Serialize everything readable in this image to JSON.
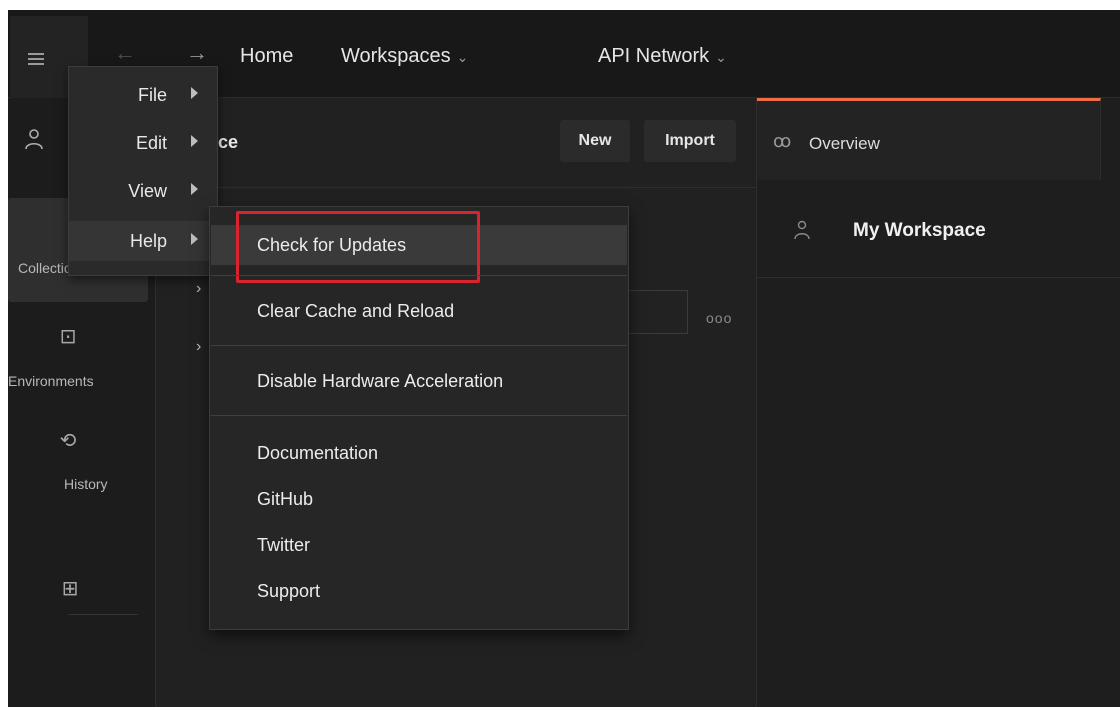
{
  "topbar": {
    "home": "Home",
    "workspaces": "Workspaces",
    "api_network": "API Network",
    "chevron": "⌄",
    "back_arrow": "←",
    "forward_arrow": "→"
  },
  "main_menu": {
    "items": [
      {
        "label": "File"
      },
      {
        "label": "Edit"
      },
      {
        "label": "View"
      },
      {
        "label": "Help"
      }
    ]
  },
  "help_menu": {
    "items": [
      {
        "label": "Check for Updates"
      },
      {
        "label": "Clear Cache and Reload"
      },
      {
        "label": "Disable Hardware Acceleration"
      },
      {
        "label": "Documentation"
      },
      {
        "label": "GitHub"
      },
      {
        "label": "Twitter"
      },
      {
        "label": "Support"
      }
    ]
  },
  "sidebar": {
    "collections": "Collections",
    "environments": "Environments",
    "history": "History"
  },
  "panel": {
    "title_fragment": "ce",
    "new_label": "New",
    "import_label": "Import",
    "more": "ooo",
    "chevron": "›"
  },
  "rightpanel": {
    "tab_overview": "Overview",
    "workspace_title": "My Workspace"
  },
  "colors": {
    "accent_tab": "#ef6c45",
    "highlight_box": "#d9232e"
  }
}
